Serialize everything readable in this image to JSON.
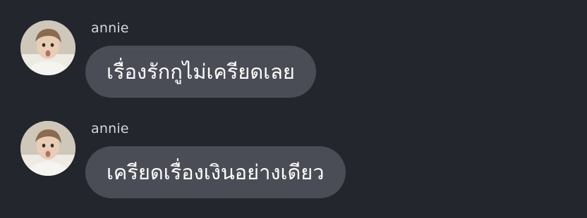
{
  "messages": [
    {
      "sender": "annie",
      "text": "เรื่องรักกูไม่เครียดเลย"
    },
    {
      "sender": "annie",
      "text": "เครียดเรื่องเงินอย่างเดียว"
    }
  ],
  "colors": {
    "background": "#24262e",
    "bubble": "#4b4d56",
    "bubble_text": "#ffffff",
    "name_text": "#d6d7db"
  },
  "icons": {
    "avatar": "profile-photo"
  }
}
